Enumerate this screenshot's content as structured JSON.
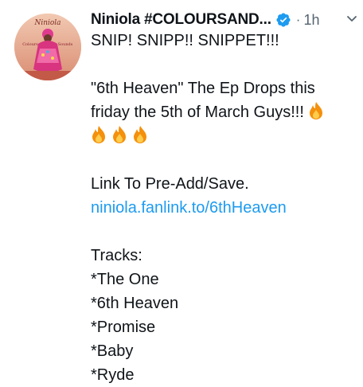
{
  "user": {
    "display_name": "Niniola #COLOURSAND...",
    "timestamp": "1h",
    "separator": "·",
    "avatar_text": "Niniola",
    "avatar_album_text": "Colours and Sounds"
  },
  "tweet": {
    "line1": "SNIP! SNIPP!! SNIPPET!!!",
    "line2": "\"6th Heaven\" The Ep Drops this",
    "line3": "friday the 5th of March Guys!!!",
    "line5": "Link To Pre-Add/Save.",
    "link": "niniola.fanlink.to/6thHeaven",
    "tracks_header": "Tracks:",
    "tracks": [
      "*The One",
      "*6th Heaven",
      "*Promise",
      "*Baby",
      "*Ryde"
    ]
  },
  "icons": {
    "verified": "verified-badge-icon",
    "more": "chevron-down-icon",
    "emoji": "fire-emoji-icon"
  },
  "colors": {
    "link": "#1d9bf0",
    "verified": "#1d9bf0",
    "muted": "#536471",
    "text": "#0f1419"
  }
}
